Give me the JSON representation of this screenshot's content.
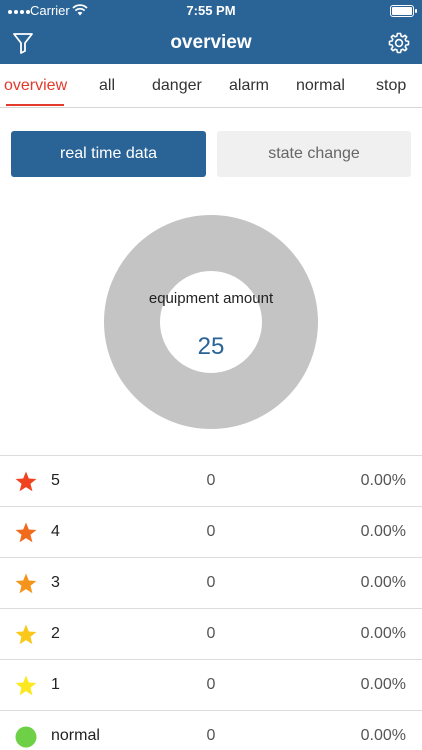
{
  "status_bar": {
    "carrier": "Carrier",
    "time": "7:55 PM"
  },
  "header": {
    "title": "overview"
  },
  "tabs": [
    {
      "label": "overview",
      "active": true
    },
    {
      "label": "all"
    },
    {
      "label": "danger"
    },
    {
      "label": "alarm"
    },
    {
      "label": "normal"
    },
    {
      "label": "stop"
    }
  ],
  "segment": {
    "primary_label": "real time data",
    "secondary_label": "state change"
  },
  "donut": {
    "label": "equipment amount",
    "value": "25",
    "ring_color": "#c4c4c4"
  },
  "rows": [
    {
      "label": "5",
      "count": "0",
      "percent": "0.00%",
      "icon": "star-icon",
      "color": "#f0421f"
    },
    {
      "label": "4",
      "count": "0",
      "percent": "0.00%",
      "icon": "star-icon",
      "color": "#f26b1d"
    },
    {
      "label": "3",
      "count": "0",
      "percent": "0.00%",
      "icon": "star-icon",
      "color": "#f4941a"
    },
    {
      "label": "2",
      "count": "0",
      "percent": "0.00%",
      "icon": "star-icon",
      "color": "#f9c81b"
    },
    {
      "label": "1",
      "count": "0",
      "percent": "0.00%",
      "icon": "star-icon",
      "color": "#fbe81f"
    },
    {
      "label": "normal",
      "count": "0",
      "percent": "0.00%",
      "icon": "circle-icon",
      "color": "#6ed046"
    }
  ],
  "colors": {
    "brand": "#2a6396",
    "active_tab": "#e33a2c"
  }
}
